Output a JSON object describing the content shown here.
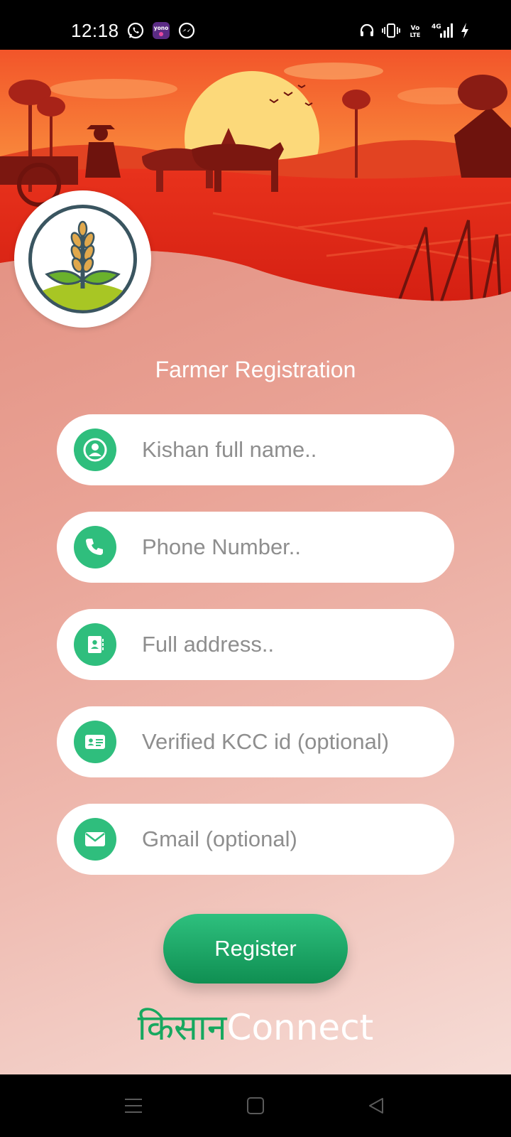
{
  "status_bar": {
    "time": "12:18",
    "left_icons": [
      "whatsapp-icon",
      "yono-sbi-icon",
      "messenger-icon"
    ],
    "right_icons": [
      "headset-icon",
      "vibrate-icon",
      "volte-icon",
      "signal-4g-icon",
      "charging-icon"
    ],
    "yono_label": "yono",
    "volte_label": "VoLTE",
    "network_label": "4G"
  },
  "header": {
    "title": "Farmer Registration"
  },
  "form": {
    "fields": [
      {
        "placeholder": "Kishan full name..",
        "icon": "user-icon"
      },
      {
        "placeholder": "Phone Number..",
        "icon": "phone-icon"
      },
      {
        "placeholder": "Full address..",
        "icon": "address-book-icon"
      },
      {
        "placeholder": "Verified KCC id (optional)",
        "icon": "id-card-icon"
      },
      {
        "placeholder": "Gmail (optional)",
        "icon": "envelope-icon"
      }
    ],
    "register_label": "Register"
  },
  "brand": {
    "hindi": "किसान",
    "english": "Connect"
  },
  "colors": {
    "accent": "#2fbe7d",
    "button_dark": "#0f8f52",
    "brand_green": "#17a85f"
  }
}
